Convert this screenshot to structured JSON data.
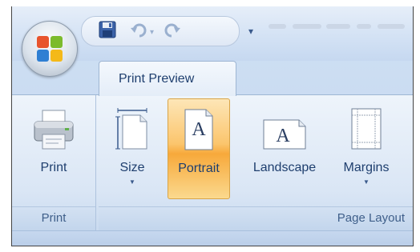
{
  "tabs": [
    {
      "label": "Print Preview",
      "active": true
    }
  ],
  "groups": {
    "print": {
      "label": "Print",
      "buttons": [
        {
          "label": "Print",
          "icon": "printer-icon"
        }
      ]
    },
    "page_layout": {
      "label": "Page Layout",
      "buttons": [
        {
          "label": "Size",
          "icon": "page-size-icon",
          "has_dropdown": true
        },
        {
          "label": "Portrait",
          "icon": "portrait-icon",
          "active": true
        },
        {
          "label": "Landscape",
          "icon": "landscape-icon"
        },
        {
          "label": "Margins",
          "icon": "margins-icon",
          "has_dropdown": true
        }
      ]
    }
  },
  "quick_access_toolbar": {
    "items": [
      "save-icon",
      "undo-icon",
      "redo-icon",
      "customize-dropdown-icon"
    ]
  },
  "office_button": {
    "icon": "office-logo-icon"
  },
  "colors": {
    "accent_active": "#f7a93b",
    "ribbon_text": "#1e3e6e",
    "group_label_text": "#3f5f8a",
    "ribbon_bg": "#dae6f5"
  }
}
